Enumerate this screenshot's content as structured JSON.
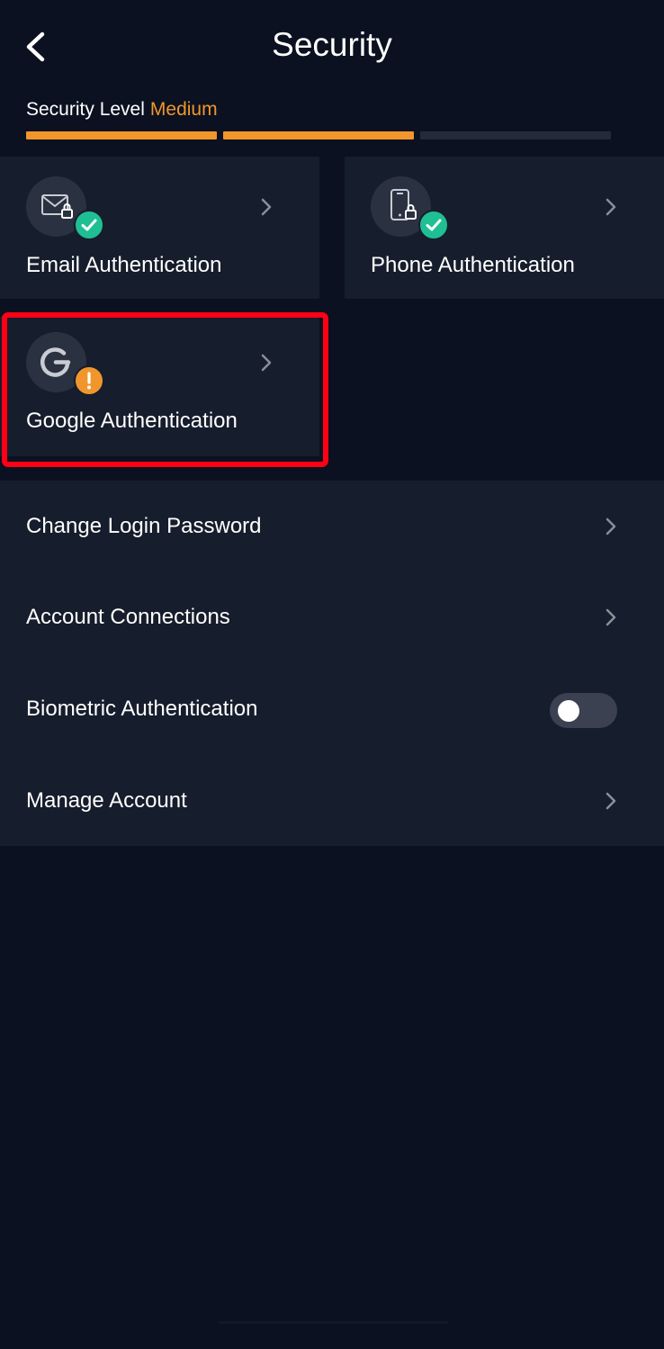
{
  "header": {
    "title": "Security",
    "back_icon": "chevron-left-icon"
  },
  "security_level": {
    "label": "Security Level",
    "value": "Medium",
    "value_color": "#f0962c",
    "filled_segments": 2,
    "total_segments": 3
  },
  "auth_cards": [
    {
      "title": "Email Authentication",
      "icon": "envelope-lock-icon",
      "status": "enabled",
      "status_icon": "check-icon",
      "status_color": "#1fbf94"
    },
    {
      "title": "Phone Authentication",
      "icon": "phone-lock-icon",
      "status": "enabled",
      "status_icon": "check-icon",
      "status_color": "#1fbf94"
    },
    {
      "title": "Google Authentication",
      "icon": "google-authenticator-icon",
      "status": "not-set",
      "status_icon": "exclamation-icon",
      "status_color": "#f0962c",
      "highlighted": true,
      "highlight_color": "#ff0014"
    }
  ],
  "settings_list": [
    {
      "label": "Change Login Password",
      "control": "chevron-right-icon"
    },
    {
      "label": "Account Connections",
      "control": "chevron-right-icon"
    },
    {
      "label": "Biometric Authentication",
      "control": "toggle",
      "toggle_on": false
    },
    {
      "label": "Manage Account",
      "control": "chevron-right-icon"
    }
  ],
  "colors": {
    "background": "#0b1120",
    "card": "#161d2c",
    "accent": "#f0962c",
    "success": "#1fbf94"
  }
}
